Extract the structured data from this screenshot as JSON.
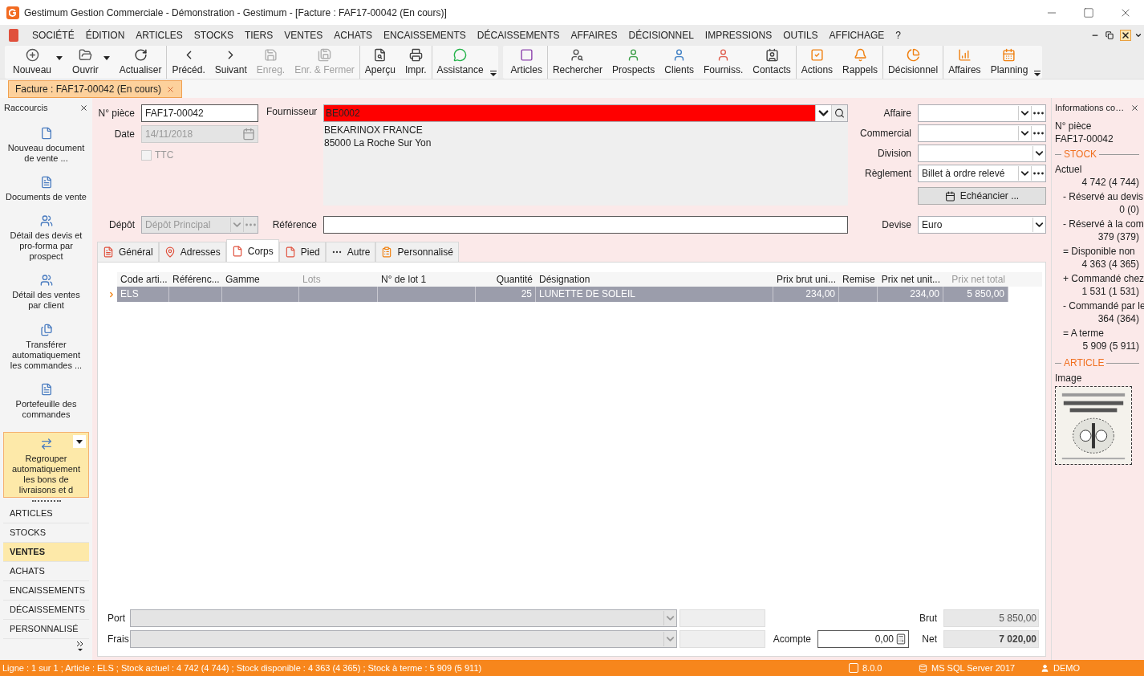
{
  "window": {
    "title": "Gestimum Gestion Commerciale - Démonstration - Gestimum - [Facture : FAF17-00042 (En cours)]"
  },
  "menu": [
    {
      "label": "SOCIÉTÉ"
    },
    {
      "label": "ÉDITION"
    },
    {
      "label": "ARTICLES"
    },
    {
      "label": "STOCKS"
    },
    {
      "label": "TIERS"
    },
    {
      "label": "VENTES"
    },
    {
      "label": "ACHATS"
    },
    {
      "label": "ENCAISSEMENTS"
    },
    {
      "label": "DÉCAISSEMENTS"
    },
    {
      "label": "AFFAIRES"
    },
    {
      "label": "DÉCISIONNEL"
    },
    {
      "label": "IMPRESSIONS"
    },
    {
      "label": "OUTILS"
    },
    {
      "label": "AFFICHAGE"
    },
    {
      "label": "?"
    }
  ],
  "toolbars": [
    {
      "groups": [
        [
          {
            "label": "Nouveau",
            "disabled": false,
            "has_menu": true
          },
          {
            "label": "Ouvrir",
            "disabled": false,
            "has_menu": true
          },
          {
            "label": "Actualiser",
            "disabled": false,
            "has_menu": false
          }
        ],
        [
          {
            "label": "Précéd.",
            "disabled": false,
            "has_menu": false
          },
          {
            "label": "Suivant",
            "disabled": false,
            "has_menu": false
          },
          {
            "label": "Enreg.",
            "disabled": true,
            "has_menu": false
          },
          {
            "label": "Enr. & Fermer",
            "disabled": true,
            "has_menu": false
          }
        ],
        [
          {
            "label": "Aperçu",
            "disabled": false,
            "has_menu": false
          },
          {
            "label": "Impr.",
            "disabled": false,
            "has_menu": false
          }
        ],
        [
          {
            "label": "Assistance",
            "disabled": false,
            "has_menu": false
          }
        ]
      ]
    },
    {
      "groups": [
        [
          {
            "label": "Articles",
            "disabled": false,
            "has_menu": false
          }
        ],
        [
          {
            "label": "Rechercher",
            "disabled": false,
            "has_menu": false
          },
          {
            "label": "Prospects",
            "disabled": false,
            "has_menu": false
          },
          {
            "label": "Clients",
            "disabled": false,
            "has_menu": false
          },
          {
            "label": "Fourniss.",
            "disabled": false,
            "has_menu": false
          },
          {
            "label": "Contacts",
            "disabled": false,
            "has_menu": false
          }
        ],
        [
          {
            "label": "Actions",
            "disabled": false,
            "has_menu": false
          },
          {
            "label": "Rappels",
            "disabled": false,
            "has_menu": false
          }
        ],
        [
          {
            "label": "Décisionnel",
            "disabled": false,
            "has_menu": false
          }
        ],
        [
          {
            "label": "Affaires",
            "disabled": false,
            "has_menu": false
          },
          {
            "label": "Planning",
            "disabled": false,
            "has_menu": false
          }
        ]
      ]
    }
  ],
  "document_tabs": [
    {
      "label": "Facture : FAF17-00042 (En cours)",
      "selected": true
    }
  ],
  "sidebar": {
    "title": "Raccourcis",
    "shortcuts": [
      {
        "label": "Nouveau document de vente ...",
        "selected": false
      },
      {
        "label": "Documents de vente",
        "selected": false
      },
      {
        "label": "Détail des devis et pro-forma par prospect",
        "selected": false
      },
      {
        "label": "Détail des ventes par client",
        "selected": false
      },
      {
        "label": "Transférer automatiquement les commandes ...",
        "selected": false
      },
      {
        "label": "Portefeuille des commandes",
        "selected": false
      },
      {
        "label": "Regrouper automatiquement les bons de livraisons et d",
        "selected": true
      }
    ],
    "sections": [
      {
        "label": "ARTICLES",
        "selected": false
      },
      {
        "label": "STOCKS",
        "selected": false
      },
      {
        "label": "VENTES",
        "selected": true
      },
      {
        "label": "ACHATS",
        "selected": false
      },
      {
        "label": "ENCAISSEMENTS",
        "selected": false
      },
      {
        "label": "DÉCAISSEMENTS",
        "selected": false
      },
      {
        "label": "PERSONNALISÉ",
        "selected": false
      }
    ]
  },
  "form": {
    "piece": {
      "label": "N° pièce",
      "value": "FAF17-00042"
    },
    "date": {
      "label": "Date",
      "value": "14/11/2018",
      "disabled": true
    },
    "ttc": {
      "label": "TTC",
      "checked": false,
      "disabled": true
    },
    "fournisseur": {
      "label": "Fournisseur",
      "value": "BE0002"
    },
    "address": [
      "BEKARINOX FRANCE",
      "85000 La Roche Sur Yon"
    ],
    "depot": {
      "label": "Dépôt",
      "value": "Dépôt Principal",
      "disabled": true
    },
    "reference": {
      "label": "Référence"
    },
    "affaire": {
      "label": "Affaire"
    },
    "commercial": {
      "label": "Commercial"
    },
    "division": {
      "label": "Division"
    },
    "reglement": {
      "label": "Règlement",
      "value": "Billet à ordre relevé"
    },
    "echeancier": {
      "label": "Echéancier ..."
    },
    "devise": {
      "label": "Devise",
      "value": "Euro"
    }
  },
  "tabs": [
    {
      "label": "Général",
      "selected": false
    },
    {
      "label": "Adresses",
      "selected": false
    },
    {
      "label": "Corps",
      "selected": true
    },
    {
      "label": "Pied",
      "selected": false
    },
    {
      "label": "Autre",
      "selected": false
    },
    {
      "label": "Personnalisé",
      "selected": false
    }
  ],
  "grid": {
    "columns": [
      {
        "label": "Code arti...",
        "disabled": false
      },
      {
        "label": "Référenc...",
        "disabled": false
      },
      {
        "label": "Gamme",
        "disabled": false
      },
      {
        "label": "Lots",
        "disabled": true
      },
      {
        "label": "N° de lot 1",
        "disabled": false
      },
      {
        "label": "Quantité",
        "disabled": false
      },
      {
        "label": "Désignation",
        "disabled": false
      },
      {
        "label": "Prix brut uni...",
        "disabled": false
      },
      {
        "label": "Remise",
        "disabled": false
      },
      {
        "label": "Prix net unit...",
        "disabled": false
      },
      {
        "label": "Prix net total",
        "disabled": true
      }
    ],
    "rows": [
      {
        "selected": true,
        "cells": [
          "ELS",
          "",
          "",
          "",
          "",
          "25",
          "LUNETTE DE SOLEIL",
          "234,00",
          "",
          "234,00",
          "5 850,00"
        ]
      }
    ]
  },
  "totals": {
    "port": {
      "label": "Port"
    },
    "frais": {
      "label": "Frais"
    },
    "acompte": {
      "label": "Acompte",
      "value": "0,00"
    },
    "brut": {
      "label": "Brut",
      "value": "5 850,00"
    },
    "net": {
      "label": "Net",
      "value": "7 020,00"
    }
  },
  "info_panel": {
    "title": "Informations co…",
    "piece_label": "N° pièce",
    "piece_value": "FAF17-00042",
    "stock_title": "STOCK",
    "stock": [
      {
        "label": "Actuel",
        "value": "4 742 (4 744)"
      },
      {
        "label": "- Réservé au devis",
        "value": "0 (0)"
      },
      {
        "label": "- Réservé à la com",
        "value": "379 (379)"
      },
      {
        "label": "= Disponible non",
        "value": "4 363 (4 365)"
      },
      {
        "label": "+ Commandé chez",
        "value": "1 531 (1 531)"
      },
      {
        "label": "- Commandé par le",
        "value": "364 (364)"
      },
      {
        "label": "= A terme",
        "value": "5 909 (5 911)"
      }
    ],
    "article_title": "ARTICLE",
    "image_label": "Image"
  },
  "status_bar": {
    "message": "Ligne : 1 sur 1 ; Article : ELS ; Stock actuel : 4 742 (4 744) ; Stock disponible : 4 363 (4 365) ; Stock à terme : 5 909 (5 911)",
    "version": "8.0.0",
    "server": "MS SQL Server 2017",
    "user": "DEMO"
  }
}
